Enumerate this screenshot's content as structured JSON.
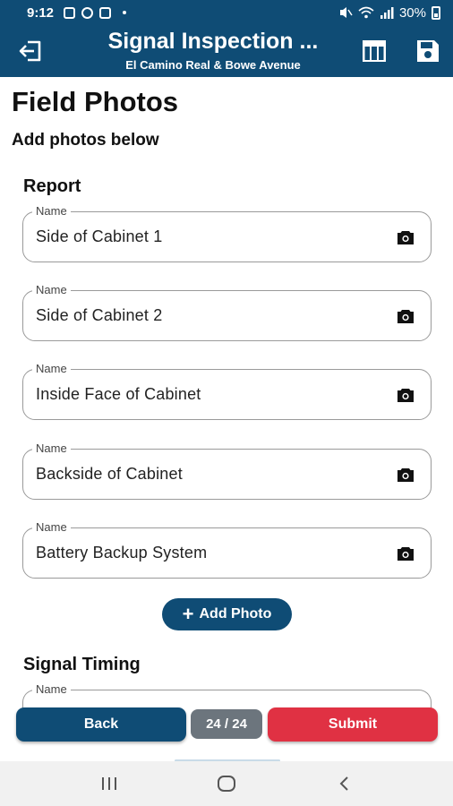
{
  "status_bar": {
    "time": "9:12",
    "battery_percent": "30%"
  },
  "header": {
    "title": "Signal Inspection ...",
    "subtitle": "El Camino Real & Bowe Avenue",
    "icons": [
      "exit-icon",
      "table-icon",
      "save-icon"
    ]
  },
  "page": {
    "title": "Field Photos",
    "subtitle": "Add photos below"
  },
  "report": {
    "heading": "Report",
    "photos": [
      {
        "label": "Name",
        "value": "Side of Cabinet 1"
      },
      {
        "label": "Name",
        "value": "Side of Cabinet 2"
      },
      {
        "label": "Name",
        "value": "Inside Face of Cabinet"
      },
      {
        "label": "Name",
        "value": "Backside of Cabinet"
      },
      {
        "label": "Name",
        "value": "Battery Backup System"
      }
    ],
    "add_photo_label": "Add Photo"
  },
  "signal_timing": {
    "heading": "Signal Timing",
    "field_label": "Name"
  },
  "footer": {
    "back_label": "Back",
    "counter": "24 / 24",
    "submit_label": "Submit"
  },
  "colors": {
    "primary": "#0f4c75",
    "submit": "#e03143",
    "counter": "#6c757d"
  }
}
